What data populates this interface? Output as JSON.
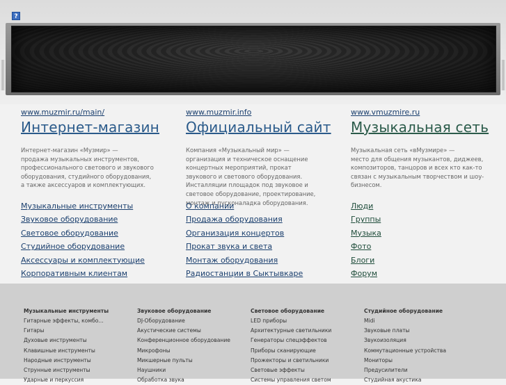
{
  "header": {
    "help_icon_glyph": "?"
  },
  "columns": [
    {
      "url": "www.muzmir.ru/main/",
      "title": "Интернет-магазин",
      "description": "Интернет-магазин «Музмир» —\nпродажа музыкальных инструментов,\nпрофессионального светового и звукового\nоборудования, студийного оборудования,\nа также аксессуаров и комплектующих.",
      "links": [
        "Музыкальные инструменты",
        "Звуковое оборудование",
        "Световое оборудование",
        "Студийное оборудование",
        "Аксессуары и комплектующие",
        "Корпоративным клиентам"
      ]
    },
    {
      "url": "www.muzmir.info",
      "title": "Официальный сайт",
      "description": "Компания «Музыкальный мир» —\nорганизация и техническое оснащение\nконцертных мероприятий, прокат\nзвукового и светового оборудования.\nИнсталляции площадок под звуковое и\nсветовое оборудование, проектирование,\nмонтаж и пусконаладка оборудования.",
      "links": [
        "О компании",
        "Продажа оборудования",
        "Организация концертов",
        "Прокат звука и света",
        "Монтаж оборудования",
        "Радиостанции в Сыктывкаре"
      ]
    },
    {
      "url": "www.vmuzmire.ru",
      "title": "Музыкальная сеть",
      "description": "Музыкальная сеть «вМузмире» —\nместо для общения музыкантов, диджеев,\nкомпозиторов, танцоров и всех кто как-то\nсвязан с музыкальным творчеством и шоу-\nбизнесом.",
      "links": [
        "Люди",
        "Группы",
        "Музыка",
        "Фото",
        "Блоги",
        "Форум"
      ]
    }
  ],
  "footer": {
    "columns": [
      {
        "heading": "Музыкальные инструменты",
        "items": [
          "Гитарные эффекты, комбо...",
          "Гитары",
          "Духовые инструменты",
          "Клавишные инструменты",
          "Народные инструменты",
          "Струнные инструменты",
          "Ударные и перкуссия"
        ]
      },
      {
        "heading": "Звуковое оборудование",
        "items": [
          "DJ-Оборудование",
          "Акустические системы",
          "Конференционное оборудование",
          "Микрофоны",
          "Микшерные пульты",
          "Наушники",
          "Обработка звука"
        ]
      },
      {
        "heading": "Световое оборудование",
        "items": [
          "LED приборы",
          "Архитектурные светильники",
          "Генераторы спецэффектов",
          "Приборы сканирующие",
          "Прожекторы и светильники",
          "Световые эффекты",
          "Системы управления светом"
        ]
      },
      {
        "heading": "Студийное оборудование",
        "items": [
          "Midi",
          "Звуковые платы",
          "Звукоизоляция",
          "Коммутационные устройства",
          "Мониторы",
          "Предусилители",
          "Студийная акустика"
        ]
      }
    ]
  }
}
